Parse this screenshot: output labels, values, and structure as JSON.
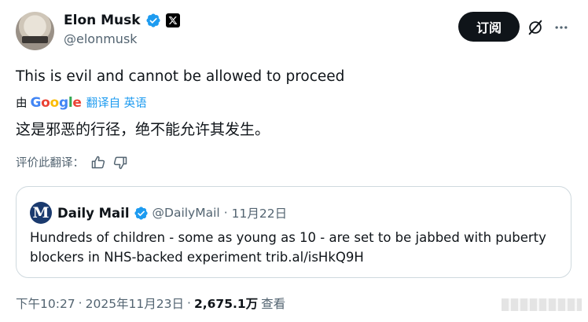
{
  "author": {
    "name": "Elon Musk",
    "handle": "@elonmusk"
  },
  "actions": {
    "subscribe_label": "订阅"
  },
  "tweet": {
    "text": "This is evil and cannot be allowed to proceed",
    "translation": {
      "by_label": "由",
      "google_letters": [
        "G",
        "o",
        "o",
        "g",
        "l",
        "e"
      ],
      "from_label": "翻译自 英语",
      "text": "这是邪恶的行径，绝不能允许其发生。",
      "rate_label": "评价此翻译："
    }
  },
  "quoted": {
    "logo_letter": "M",
    "name": "Daily Mail",
    "handle": "@DailyMail",
    "separator": "·",
    "date": "11月22日",
    "text": "Hundreds of children - some as young as 10 - are set to be jabbed with puberty blockers in NHS-backed experiment trib.al/isHkQ9H"
  },
  "meta": {
    "time": "下午10:27",
    "sep1": "·",
    "date": "2025年11月23日",
    "sep2": "·",
    "views_count": "2,675.1万",
    "views_label": "查看"
  },
  "colors": {
    "verified_blue": "#1d9bf0",
    "text_primary": "#0f1419",
    "text_secondary": "#536471",
    "border": "#cfd9de",
    "daily_mail_navy": "#1a3a6e"
  },
  "icons": [
    "verified-badge-icon",
    "x-logo-icon",
    "grok-icon",
    "more-icon",
    "thumbs-up-icon",
    "thumbs-down-icon"
  ]
}
